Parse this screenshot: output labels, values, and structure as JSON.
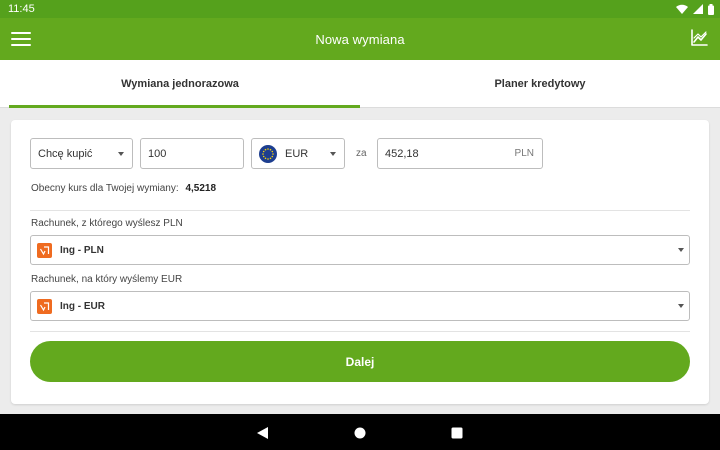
{
  "status_bar": {
    "time": "11:45",
    "icons": [
      "wifi-icon",
      "signal-icon",
      "battery-icon"
    ]
  },
  "app_bar": {
    "title": "Nowa wymiana",
    "left_icon": "menu-icon",
    "right_icon": "chart-icon"
  },
  "tabs": [
    {
      "label": "Wymiana jednorazowa",
      "active": true
    },
    {
      "label": "Planer kredytowy",
      "active": false
    }
  ],
  "exchange": {
    "action_value": "Chcę kupić",
    "amount_value": "100",
    "currency_value": "EUR",
    "for_label": "za",
    "result_value": "452,18",
    "result_unit": "PLN",
    "rate_label": "Obecny kurs dla Twojej wymiany:",
    "rate_value": "4,5218"
  },
  "accounts": {
    "from_label": "Rachunek, z którego wyślesz PLN",
    "from_value": "Ing - PLN",
    "to_label": "Rachunek, na który wyślemy EUR",
    "to_value": "Ing - EUR"
  },
  "next_button": "Dalej",
  "colors": {
    "accent": "#63a91e",
    "status_bar": "#55a11c",
    "bank_icon": "#ef6b20",
    "eu_flag": "#1d3e8f"
  }
}
